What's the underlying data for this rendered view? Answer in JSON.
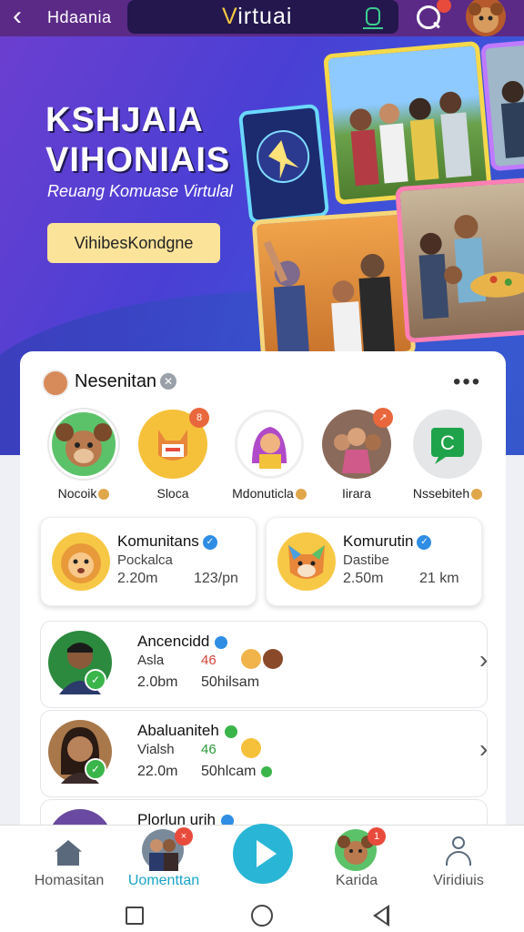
{
  "header": {
    "back_label": "‹",
    "title": "Hdaania",
    "brand_first": "V",
    "brand_rest": "irtuai"
  },
  "hero": {
    "heading_line1": "KSHJAIA",
    "heading_line2": "VIHONIAIS",
    "subtitle": "Reuang Komuase Virtulal",
    "cta_label": "VihibesKondgne"
  },
  "section": {
    "title": "Nesenitan",
    "more_label": "•••"
  },
  "stories": [
    {
      "label": "Nocoik",
      "badge": ""
    },
    {
      "label": "Sloca",
      "badge": "8"
    },
    {
      "label": "Mdonuticla",
      "badge": ""
    },
    {
      "label": "Iirara",
      "badge": "↗"
    },
    {
      "label": "Nssebiteh",
      "badge": ""
    }
  ],
  "communities": [
    {
      "name": "Komunitans",
      "sub": "Pockalca",
      "stat1": "2.20m",
      "stat2": "123/pn"
    },
    {
      "name": "Komurutin",
      "sub": "Dastibe",
      "stat1": "2.50m",
      "stat2": "21 km"
    }
  ],
  "rows": [
    {
      "name": "Ancencidd",
      "sub": "Asla",
      "num": "46",
      "stat1": "2.0bm",
      "stat2": "50hilsam",
      "num_color": "#d0443a"
    },
    {
      "name": "Abaluaniteh",
      "sub": "Vialsh",
      "num": "46",
      "stat1": "22.0m",
      "stat2": "50hlcam",
      "num_color": "#2a9a3a"
    },
    {
      "name": "Plorlun urih",
      "sub": "",
      "num": "",
      "stat1": "",
      "stat2": "",
      "num_color": "#333"
    }
  ],
  "nav": {
    "home": "Homasitan",
    "comments": "Uomenttan",
    "comments_badge": "×",
    "karida": "Karida",
    "karida_badge": "1",
    "profile": "Viridiuis"
  },
  "colors": {
    "accent": "#29b6d6",
    "brand_yellow": "#f5c842",
    "hero_purple": "#6b3fd0",
    "badge_red": "#e84b3c"
  }
}
